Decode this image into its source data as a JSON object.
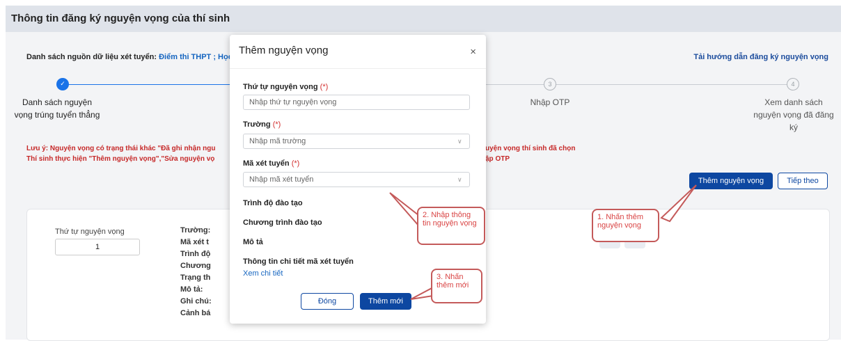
{
  "page": {
    "title": "Thông tin đăng ký nguyện vọng của thí sinh",
    "sources_label": "Danh sách nguồn dữ liệu xét tuyển:",
    "sources_value": "Điểm thi THPT ; Học",
    "guide_link": "Tải hướng dẫn đăng ký nguyện vọng"
  },
  "steps": [
    {
      "number": "✓",
      "label": "Danh sách nguyện vọng trúng tuyển thẳng"
    },
    {
      "number": "3",
      "label": "Nhập OTP"
    },
    {
      "number": "4",
      "label": "Xem danh sách nguyện vọng đã đăng ký"
    }
  ],
  "notes": {
    "line1_left": "Lưu ý: Nguyện vọng có trạng thái khác \"Đã ghi nhận ngu",
    "line2_left": "Thí sinh thực hiện \"Thêm nguyện vọng\",\"Sửa nguyện vọ",
    "line1_right": "uyện vọng thí sinh đã chọn",
    "line2_right": "ập OTP"
  },
  "actions": {
    "add_label": "Thêm nguyện vọng",
    "next_label": "Tiếp theo"
  },
  "card": {
    "order_label": "Thứ tự nguyện vọng",
    "order_value": "1",
    "fields": [
      "Trường:",
      "Mã xét t",
      "Trình độ",
      "Chương",
      "Trạng th",
      "Mô tả:",
      "Ghi chú:",
      "Cảnh bá"
    ]
  },
  "modal": {
    "title": "Thêm nguyện vọng",
    "close": "×",
    "order_label": "Thứ tự nguyện vọng",
    "order_req": "(*)",
    "order_placeholder": "Nhập thứ tự nguyện vọng",
    "school_label": "Trường",
    "school_req": "(*)",
    "school_placeholder": "Nhập mã trường",
    "code_label": "Mã xét tuyển",
    "code_req": "(*)",
    "code_placeholder": "Nhập mã xét tuyển",
    "level_label": "Trình độ đào tạo",
    "program_label": "Chương trình đào tạo",
    "desc_label": "Mô tả",
    "detail_label": "Thông tin chi tiết mã xét tuyển",
    "detail_link": "Xem chi tiết",
    "close_button": "Đóng",
    "add_button": "Thêm mới"
  },
  "callouts": {
    "c1": "1. Nhấn thêm nguyện vọng",
    "c2": "2. Nhập thông tin nguyện vọng",
    "c3": "3. Nhấn thêm mới"
  },
  "colors": {
    "accent": "#0d47a1",
    "warning": "#c62828",
    "callout": "#c45a5a"
  }
}
